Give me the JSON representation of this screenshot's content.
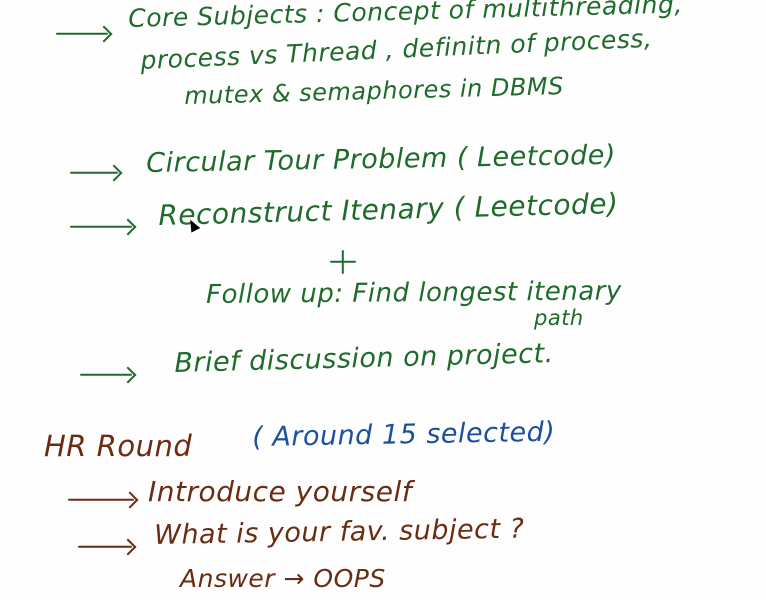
{
  "colors": {
    "background": "#fefefe",
    "green_ink": "#1f6b2b",
    "blue_ink": "#1c4fa0",
    "brown_ink": "#6a2c12"
  },
  "notes": {
    "core_subjects": {
      "line1": "Core Subjects : Concept of multithreading,",
      "line2": "process vs Thread , definitn of process,",
      "line3": "mutex & semaphores in DBMS"
    },
    "circular_tour": "Circular Tour Problem ( Leetcode)",
    "reconstruct_itinerary": "Reconstruct Itenary ( Leetcode)",
    "plus_symbol": "+",
    "follow_up": {
      "line1": "Follow up: Find longest itenary",
      "line2": "path"
    },
    "brief_discussion": "Brief discussion on project."
  },
  "hr_round": {
    "title": "HR Round",
    "note": "( Around 15 selected)",
    "item1": "Introduce yourself",
    "item2": "What is your fav. subject ?",
    "answer": "Answer → OOPS"
  },
  "icons": {
    "arrow": "right-arrow-icon",
    "cursor": "mouse-pointer-icon"
  }
}
